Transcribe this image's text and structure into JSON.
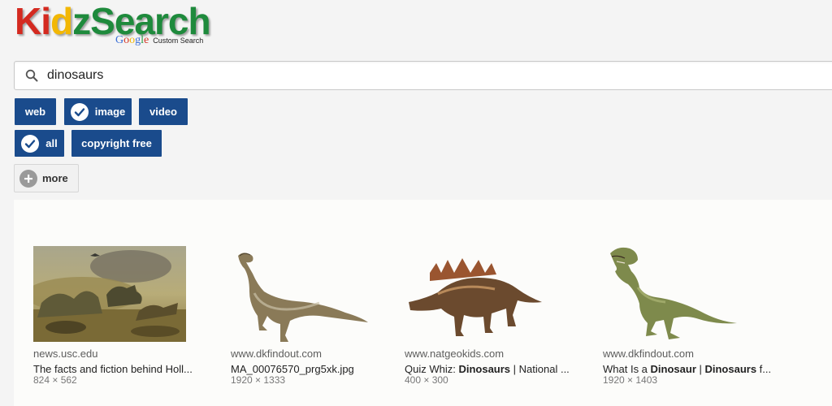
{
  "logo": {
    "text": "KidzSearch",
    "letter_colors": [
      "#d42a20",
      "#d42a20",
      "#f2b705",
      "#1e8a3c",
      "#1e8a3c",
      "#1e8a3c",
      "#1e8a3c",
      "#1e8a3c",
      "#1e8a3c",
      "#1e8a3c"
    ],
    "powered_by": "Google",
    "tagline": "Custom Search"
  },
  "search": {
    "query": "dinosaurs",
    "icon": "search-icon"
  },
  "filters": {
    "type": [
      {
        "label": "web",
        "checked": false
      },
      {
        "label": "image",
        "checked": true
      },
      {
        "label": "video",
        "checked": false
      }
    ],
    "license": [
      {
        "label": "all",
        "checked": true
      },
      {
        "label": "copyright free",
        "checked": false
      }
    ],
    "more_label": "more"
  },
  "colors": {
    "button_bg": "#1a4b8c",
    "page_bg": "#f4f4f4"
  },
  "results": [
    {
      "domain": "news.usc.edu",
      "title_parts": [
        {
          "text": "The facts and fiction behind Holl...",
          "bold": false
        }
      ],
      "size": "824 × 562"
    },
    {
      "domain": "www.dkfindout.com",
      "title_parts": [
        {
          "text": "MA_00076570_prg5xk.jpg",
          "bold": false
        }
      ],
      "size": "1920 × 1333"
    },
    {
      "domain": "www.natgeokids.com",
      "title_parts": [
        {
          "text": "Quiz Whiz: ",
          "bold": false
        },
        {
          "text": "Dinosaurs",
          "bold": true
        },
        {
          "text": " | National ...",
          "bold": false
        }
      ],
      "size": "400 × 300"
    },
    {
      "domain": "www.dkfindout.com",
      "title_parts": [
        {
          "text": "What Is a ",
          "bold": false
        },
        {
          "text": "Dinosaur",
          "bold": true
        },
        {
          "text": " | ",
          "bold": false
        },
        {
          "text": "Dinosaurs",
          "bold": true
        },
        {
          "text": " f...",
          "bold": false
        }
      ],
      "size": "1920 × 1403"
    }
  ]
}
